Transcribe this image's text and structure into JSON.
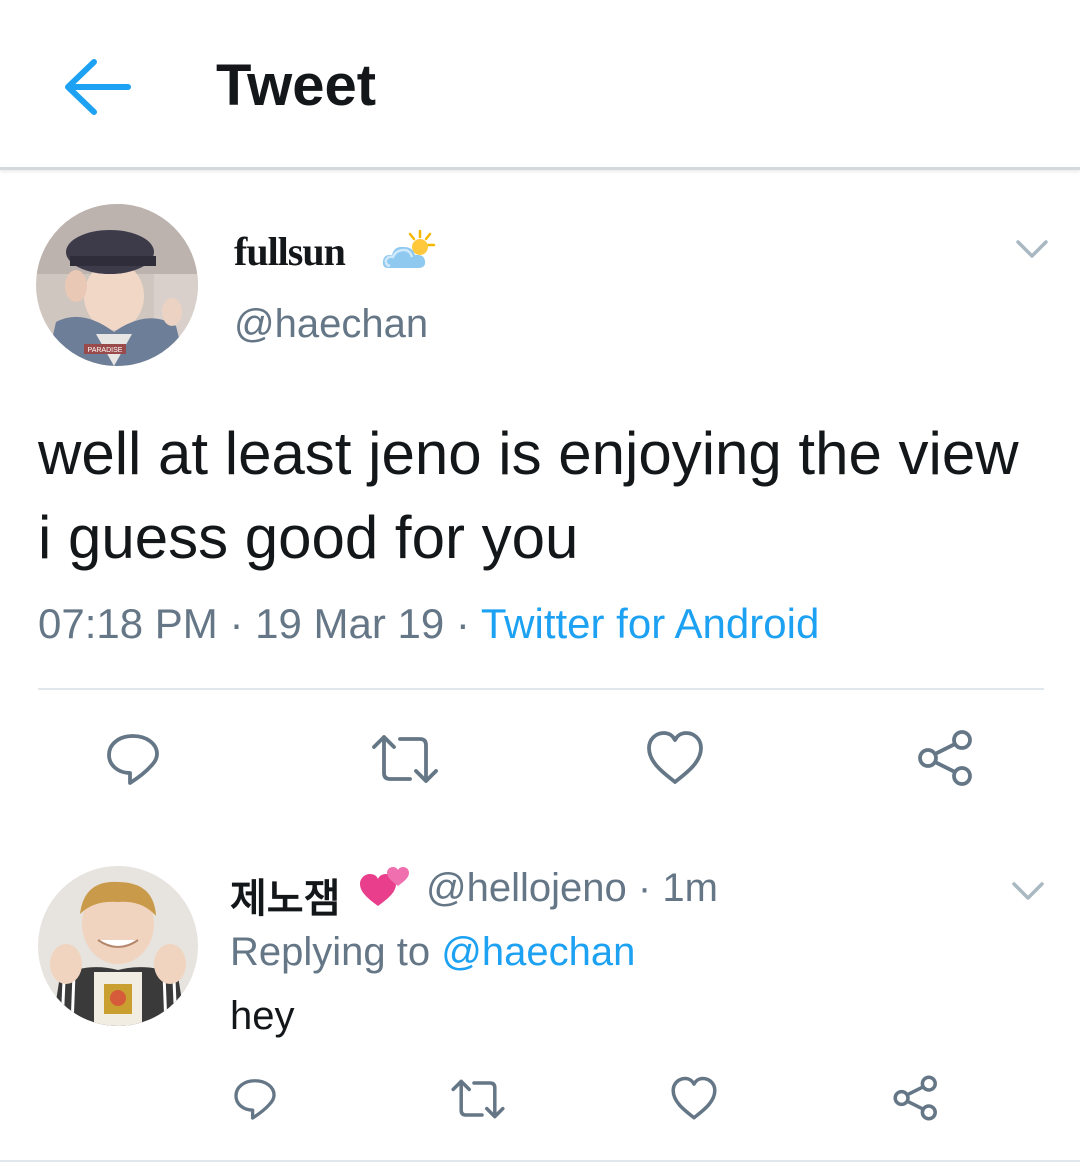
{
  "header": {
    "title": "Tweet",
    "back_icon": "arrow-left-icon"
  },
  "colors": {
    "accent": "#1da1f2",
    "secondary_text": "#657786",
    "primary_text": "#14171a",
    "divider": "#e1e8ed"
  },
  "tweet": {
    "display_name": "fullsun",
    "name_emoji_icon": "sun-behind-cloud-icon",
    "handle": "@haechan",
    "text": "well at least jeno is enjoying the view i guess good for you",
    "time": "07:18 PM",
    "date": "19 Mar 19",
    "separator": "·",
    "source": "Twitter for Android",
    "avatar_caption": "PARADISE",
    "actions": [
      "reply-icon",
      "retweet-icon",
      "like-icon",
      "share-icon"
    ]
  },
  "reply": {
    "display_name": "제노잼",
    "name_emoji_icon": "two-hearts-icon",
    "handle": "@hellojeno",
    "separator": "·",
    "age": "1m",
    "replying_prefix": "Replying to",
    "replying_to": "@haechan",
    "text": "hey",
    "actions": [
      "reply-icon",
      "retweet-icon",
      "like-icon",
      "share-icon"
    ]
  }
}
